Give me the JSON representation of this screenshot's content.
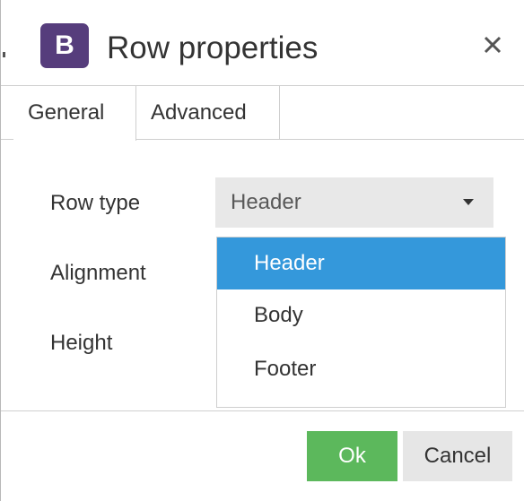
{
  "dialog": {
    "logo_letter": "B",
    "title": "Row properties",
    "close_icon": "close-icon"
  },
  "tabs": [
    {
      "label": "General",
      "active": true
    },
    {
      "label": "Advanced",
      "active": false
    }
  ],
  "form": {
    "row_type_label": "Row type",
    "alignment_label": "Alignment",
    "height_label": "Height",
    "row_type_value": "Header",
    "row_type_options": [
      {
        "label": "Header",
        "selected": true
      },
      {
        "label": "Body",
        "selected": false
      },
      {
        "label": "Footer",
        "selected": false
      }
    ]
  },
  "buttons": {
    "ok_label": "Ok",
    "cancel_label": "Cancel"
  },
  "colors": {
    "logo_bg": "#563d7c",
    "selected_option_bg": "#3498db",
    "ok_bg": "#5cb85c",
    "cancel_bg": "#e6e6e6"
  }
}
